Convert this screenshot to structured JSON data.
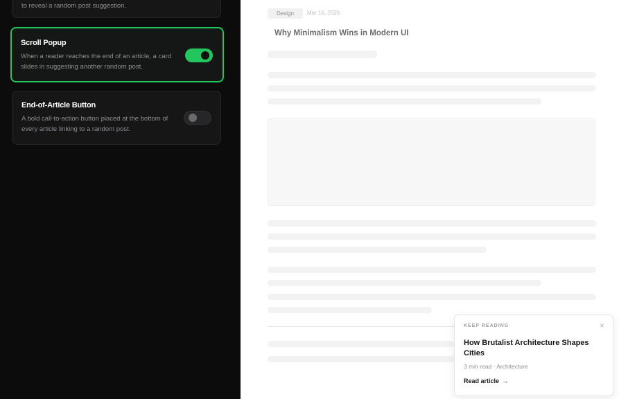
{
  "settings": {
    "cards": [
      {
        "title": "",
        "description": "to reveal a random post suggestion.",
        "enabled": null
      },
      {
        "title": "Scroll Popup",
        "description": "When a reader reaches the end of an article, a card slides in suggesting another random post.",
        "enabled": true
      },
      {
        "title": "End-of-Article Button",
        "description": "A bold call-to-action button placed at the bottom of every article linking to a random post.",
        "enabled": false
      }
    ],
    "accent_color": "#22c55e"
  },
  "preview": {
    "tag": "Design",
    "date": "Mar 16, 2026",
    "title": "Why Minimalism Wins in Modern UI"
  },
  "popup": {
    "label": "KEEP READING",
    "close": "×",
    "title": "How Brutalist Architecture Shapes Cities",
    "meta": "3 min read · Architecture",
    "link_label": "Read article",
    "link_arrow": "→"
  }
}
